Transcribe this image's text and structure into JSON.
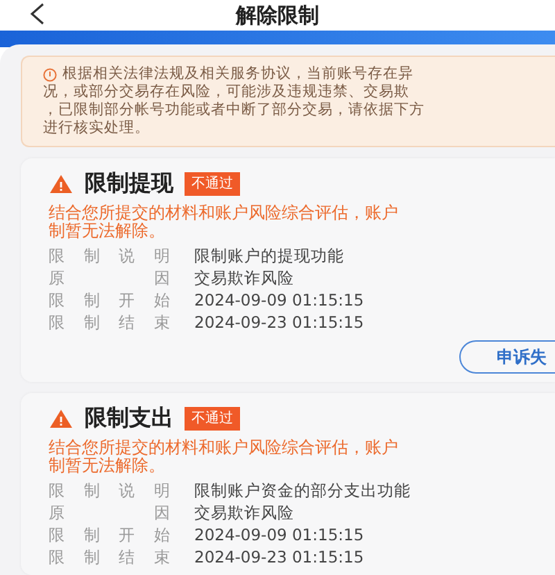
{
  "header": {
    "title": "解除限制"
  },
  "notice": {
    "lines": [
      "根据相关法律法规及相关服务协议，当前账号存在异",
      "况，或部分交易存在风险，可能涉及违规违禁、交易欺",
      "，已限制部分帐号功能或者中断了部分交易，请依据下方",
      "进行核实处理。"
    ]
  },
  "cards": [
    {
      "title": "限制提现",
      "badge": "不通过",
      "message_lines": [
        "结合您所提交的材料和账户风险综合评估，账户",
        "制暂无法解除。"
      ],
      "rows": [
        {
          "label": "限制说明",
          "value": "限制账户的提现功能"
        },
        {
          "label": "原因",
          "value": "交易欺诈风险"
        },
        {
          "label": "限制开始",
          "value": "2024-09-09 01:15:15"
        },
        {
          "label": "限制结束",
          "value": "2024-09-23 01:15:15"
        }
      ],
      "button": "申诉失"
    },
    {
      "title": "限制支出",
      "badge": "不通过",
      "message_lines": [
        "结合您所提交的材料和账户风险综合评估，账户",
        "制暂无法解除。"
      ],
      "rows": [
        {
          "label": "限制说明",
          "value": "限制账户资金的部分支出功能"
        },
        {
          "label": "原因",
          "value": "交易欺诈风险"
        },
        {
          "label": "限制开始",
          "value": "2024-09-09 01:15:15"
        },
        {
          "label": "限制结束",
          "value": "2024-09-23 01:15:15"
        }
      ]
    }
  ]
}
